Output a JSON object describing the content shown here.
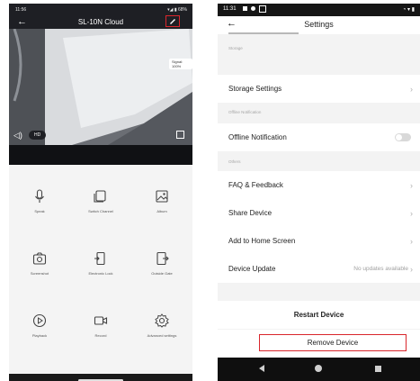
{
  "left_phone": {
    "status": {
      "time": "11:56",
      "right": "▾◢ ▮ 68%"
    },
    "header": {
      "title": "SL-10N Cloud"
    },
    "video": {
      "signal_label": "Signal: 100%",
      "hd_label": "HD"
    },
    "controls": [
      {
        "label": "Speak",
        "icon": "mic-icon"
      },
      {
        "label": "Switch Channel",
        "icon": "switch-channel-icon"
      },
      {
        "label": "Album",
        "icon": "album-icon"
      },
      {
        "label": "Screenshot",
        "icon": "camera-icon"
      },
      {
        "label": "Electronic Lock",
        "icon": "electronic-lock-icon"
      },
      {
        "label": "Outside Gate",
        "icon": "outside-gate-icon"
      },
      {
        "label": "Playback",
        "icon": "playback-icon"
      },
      {
        "label": "Record",
        "icon": "record-icon"
      },
      {
        "label": "Advanced settings",
        "icon": "gear-icon"
      }
    ]
  },
  "right_phone": {
    "status": {
      "time": "11:31"
    },
    "header": {
      "title": "Settings"
    },
    "sections": {
      "storage": "Storage",
      "offline": "Offline Notification",
      "others": "Others"
    },
    "rows": {
      "storage_settings": "Storage Settings",
      "offline_notification": "Offline Notification",
      "faq": "FAQ & Feedback",
      "share": "Share Device",
      "add_home": "Add to Home Screen",
      "device_update": "Device Update",
      "device_update_value": "No updates available"
    },
    "offline_toggle_on": false,
    "buttons": {
      "restart": "Restart Device",
      "remove": "Remove Device"
    },
    "highlight_color": "#d9262c"
  }
}
